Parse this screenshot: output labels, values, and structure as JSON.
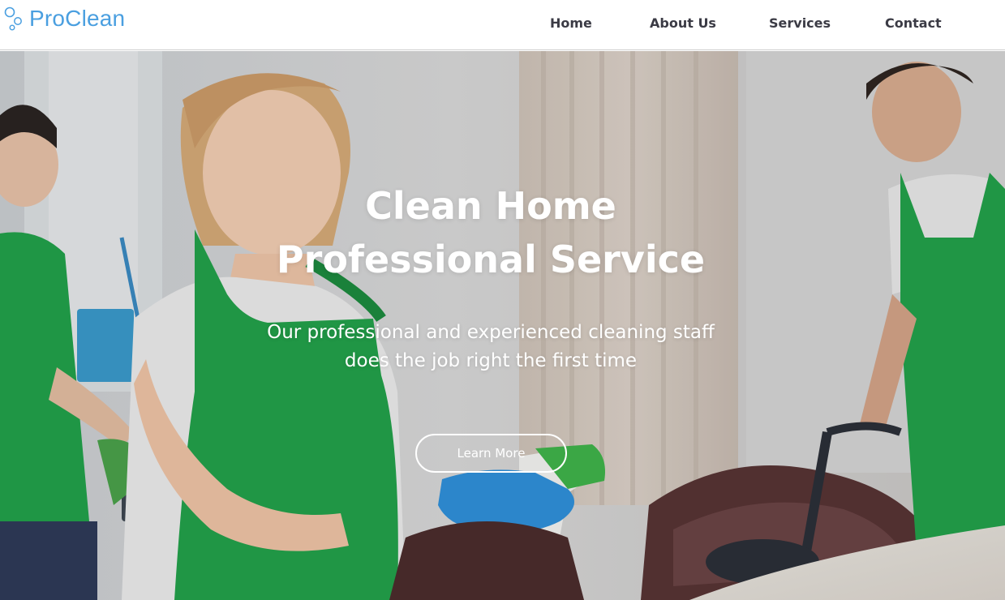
{
  "brand": {
    "name": "ProClean",
    "accent_color": "#4a9fe0",
    "icon": "bubbles-icon"
  },
  "nav": {
    "items": [
      {
        "label": "Home"
      },
      {
        "label": "About Us"
      },
      {
        "label": "Services"
      },
      {
        "label": "Contact"
      }
    ],
    "text_color": "#3b3b45"
  },
  "hero": {
    "title_line1": "Clean Home",
    "title_line2": "Professional Service",
    "subtitle_line1": "Our professional and experienced cleaning staff",
    "subtitle_line2": "does the job right the first time",
    "button_label": "Learn More",
    "background": "photo of cleaning staff in green aprons",
    "apron_color": "#1f9a45",
    "glove_color": "#2f8fd8"
  }
}
